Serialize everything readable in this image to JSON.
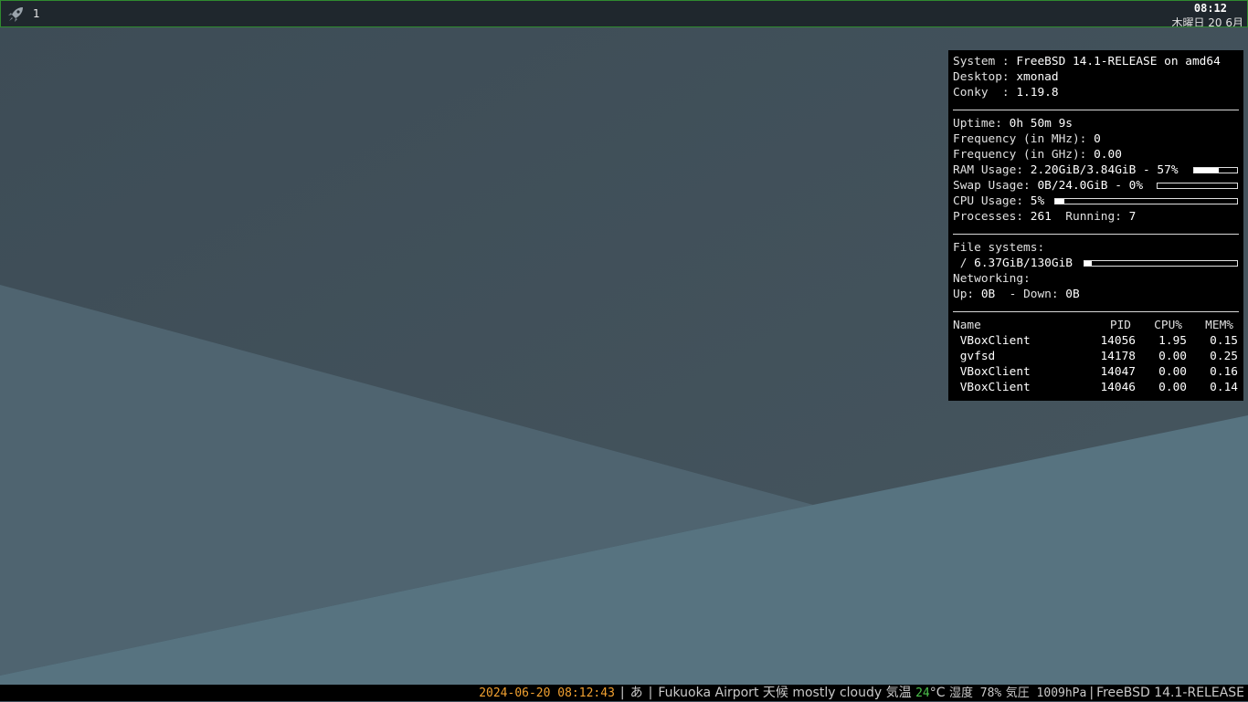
{
  "topbar": {
    "workspace": "1",
    "clock": "08:12",
    "date": "木曜日 20 6月"
  },
  "conky": {
    "system_label": "System : ",
    "system": "FreeBSD 14.1-RELEASE on amd64",
    "desktop_label": "Desktop: ",
    "desktop": "xmonad",
    "conky_label": "Conky  : ",
    "conky_version": "1.19.8",
    "uptime_label": "Uptime: ",
    "uptime": "0h 50m 9s",
    "freq_mhz_label": "Frequency (in MHz): ",
    "freq_mhz": "0",
    "freq_ghz_label": "Frequency (in GHz): ",
    "freq_ghz": "0.00",
    "ram_label": "RAM Usage: ",
    "ram": "2.20GiB/3.84GiB - 57%",
    "ram_pct": 57,
    "swap_label": "Swap Usage: ",
    "swap": "0B/24.0GiB - 0%",
    "swap_pct": 0,
    "cpu_label": "CPU Usage: ",
    "cpu": "5%",
    "cpu_pct": 5,
    "processes_label": "Processes: ",
    "processes": "261",
    "running_label": "  Running: ",
    "running": "7",
    "fs_label": "File systems:",
    "fs_root": " / ",
    "fs_usage": "6.37GiB/130GiB",
    "fs_pct": 5,
    "net_label": "Networking:",
    "up_label": "Up: ",
    "up": "0B",
    "down_label": "  - Down: ",
    "down": "0B",
    "proc_headers": {
      "name": "Name",
      "pid": "PID",
      "cpu": "CPU%",
      "mem": "MEM%"
    },
    "proc_rows": [
      {
        "name": " VBoxClient",
        "pid": "14056",
        "cpu": "1.95",
        "mem": "0.15"
      },
      {
        "name": " gvfsd",
        "pid": "14178",
        "cpu": "0.00",
        "mem": "0.25"
      },
      {
        "name": " VBoxClient",
        "pid": "14047",
        "cpu": "0.00",
        "mem": "0.16"
      },
      {
        "name": " VBoxClient",
        "pid": "14046",
        "cpu": "0.00",
        "mem": "0.14"
      }
    ]
  },
  "bottombar": {
    "datetime": "2024-06-20 08:12:43",
    "sep": "|",
    "ime": "あ",
    "location": "Fukuoka Airport 天候",
    "weather": "mostly cloudy",
    "temp_label": "気温",
    "temp": "24",
    "temp_unit": "°C",
    "humidity": "湿度 78%",
    "pressure": "気圧 1009hPa",
    "os": "FreeBSD 14.1-RELEASE"
  },
  "icons": {
    "launcher": "rocket-icon"
  },
  "colors": {
    "topbar_border": "#2f8a2f",
    "datetime": "#f0a030",
    "temp": "#4cc04c",
    "conky_bg": "#000000"
  }
}
